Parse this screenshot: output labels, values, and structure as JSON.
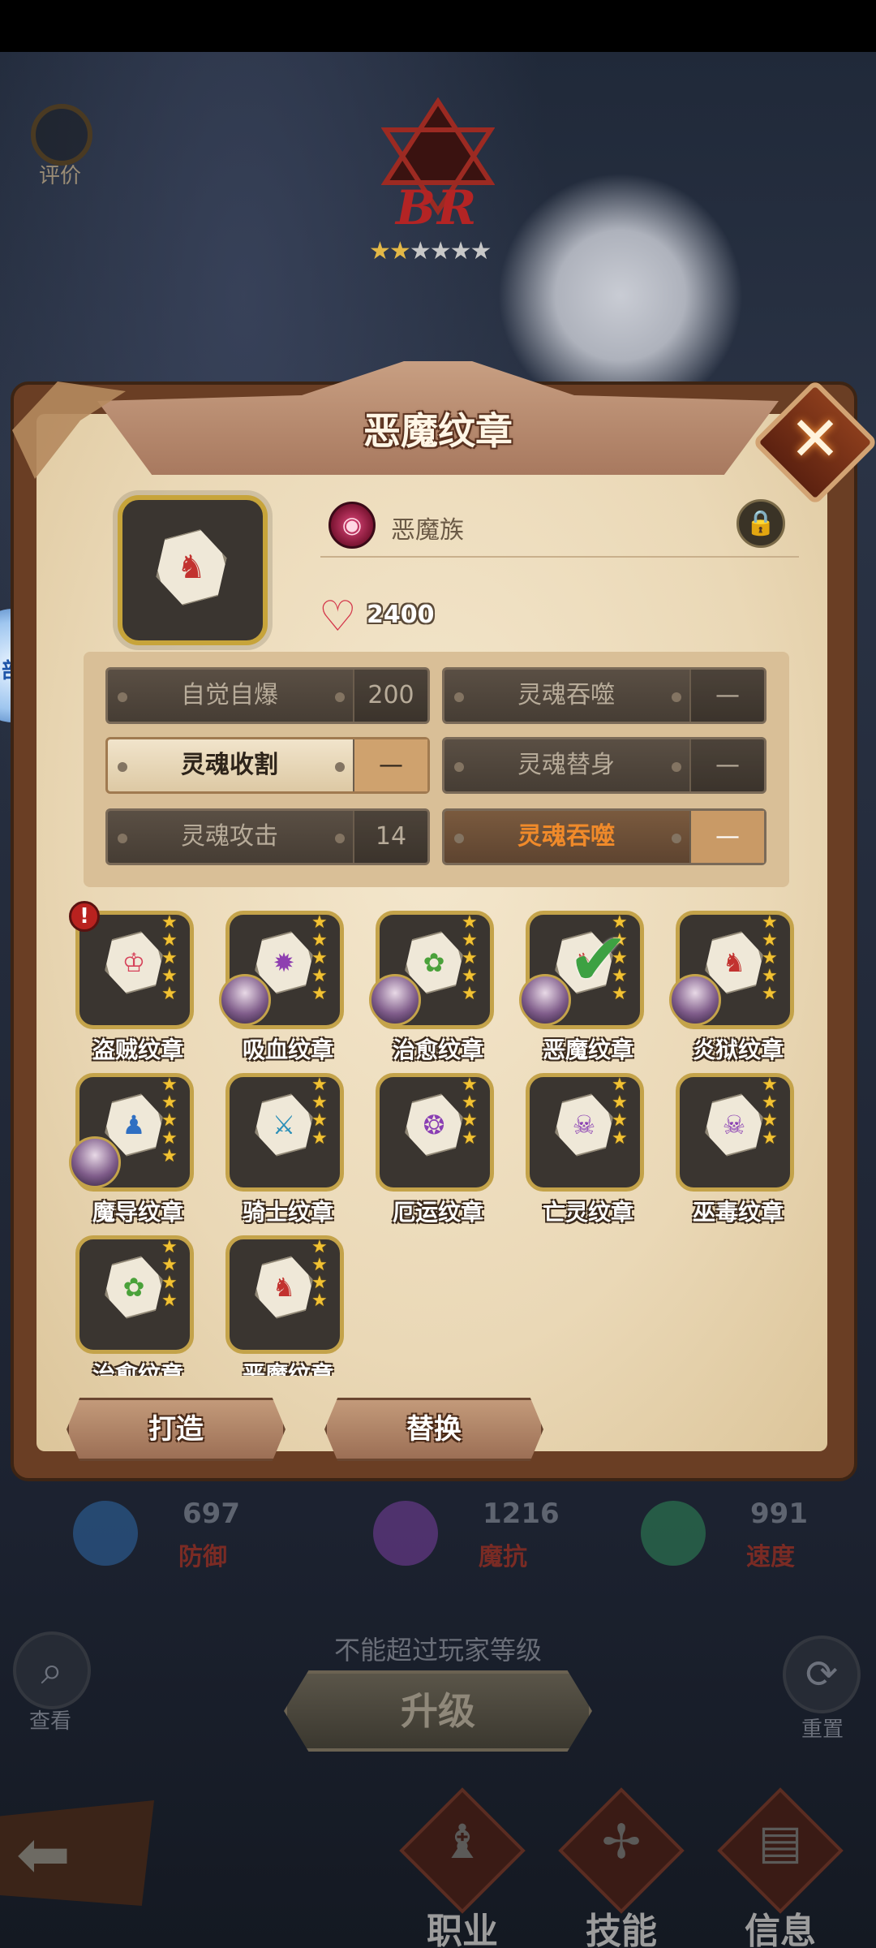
{
  "top": {
    "rate_label": "评价",
    "rank_text": "BR",
    "rank_stars_filled": 2,
    "rank_stars_total": 6,
    "side_badge_text": "部别"
  },
  "dialog": {
    "title": "恶魔纹章",
    "race_name": "恶魔族",
    "heart_value": "2400",
    "skills": [
      {
        "name": "自觉自爆",
        "value": "200",
        "state": "normal"
      },
      {
        "name": "灵魂吞噬",
        "value": "—",
        "state": "normal"
      },
      {
        "name": "灵魂收割",
        "value": "—",
        "state": "active"
      },
      {
        "name": "灵魂替身",
        "value": "—",
        "state": "normal"
      },
      {
        "name": "灵魂攻击",
        "value": "14",
        "state": "normal"
      },
      {
        "name": "灵魂吞噬",
        "value": "—",
        "state": "highlight"
      }
    ],
    "emblems": [
      {
        "label": "盗贼纹章",
        "symbol": "♔",
        "color": "#d6425a",
        "stars": 5,
        "hero": false,
        "check": false,
        "alert": true
      },
      {
        "label": "吸血纹章",
        "symbol": "✹",
        "color": "#8e3fb0",
        "stars": 5,
        "hero": true,
        "check": false,
        "alert": false
      },
      {
        "label": "治愈纹章",
        "symbol": "✿",
        "color": "#4aa13a",
        "stars": 5,
        "hero": true,
        "check": false,
        "alert": false
      },
      {
        "label": "恶魔纹章",
        "symbol": "♞",
        "color": "#c2322f",
        "stars": 5,
        "hero": true,
        "check": true,
        "alert": false
      },
      {
        "label": "炎狱纹章",
        "symbol": "♞",
        "color": "#c2322f",
        "stars": 5,
        "hero": true,
        "check": false,
        "alert": false
      },
      {
        "label": "魔导纹章",
        "symbol": "♟",
        "color": "#2f6fc2",
        "stars": 5,
        "hero": true,
        "check": false,
        "alert": false
      },
      {
        "label": "骑士纹章",
        "symbol": "⚔",
        "color": "#2a8fb8",
        "stars": 4,
        "hero": false,
        "check": false,
        "alert": false
      },
      {
        "label": "厄运纹章",
        "symbol": "❂",
        "color": "#8a3fb4",
        "stars": 4,
        "hero": false,
        "check": false,
        "alert": false
      },
      {
        "label": "亡灵纹章",
        "symbol": "☠",
        "color": "#8a3fb4",
        "stars": 4,
        "hero": false,
        "check": false,
        "alert": false
      },
      {
        "label": "巫毒纹章",
        "symbol": "☠",
        "color": "#8a3fb4",
        "stars": 4,
        "hero": false,
        "check": false,
        "alert": false
      },
      {
        "label": "治愈纹章",
        "symbol": "✿",
        "color": "#4aa13a",
        "stars": 4,
        "hero": false,
        "check": false,
        "alert": false
      },
      {
        "label": "恶魔纹章",
        "symbol": "♞",
        "color": "#c2322f",
        "stars": 4,
        "hero": false,
        "check": false,
        "alert": false
      }
    ],
    "forge_label": "打造",
    "replace_label": "替换"
  },
  "stats": [
    {
      "value": "697",
      "label": "防御",
      "color": "#2f6aa8"
    },
    {
      "value": "1216",
      "label": "魔抗",
      "color": "#7a3fa0"
    },
    {
      "value": "991",
      "label": "速度",
      "color": "#2f8a5a"
    }
  ],
  "bottom": {
    "warning": "不能超过玩家等级",
    "upgrade_label": "升级",
    "view_label": "查看",
    "reset_label": "重置",
    "nav": [
      {
        "label": "职业",
        "icon": "♝"
      },
      {
        "label": "技能",
        "icon": "✢"
      },
      {
        "label": "信息",
        "icon": "▤"
      }
    ]
  }
}
